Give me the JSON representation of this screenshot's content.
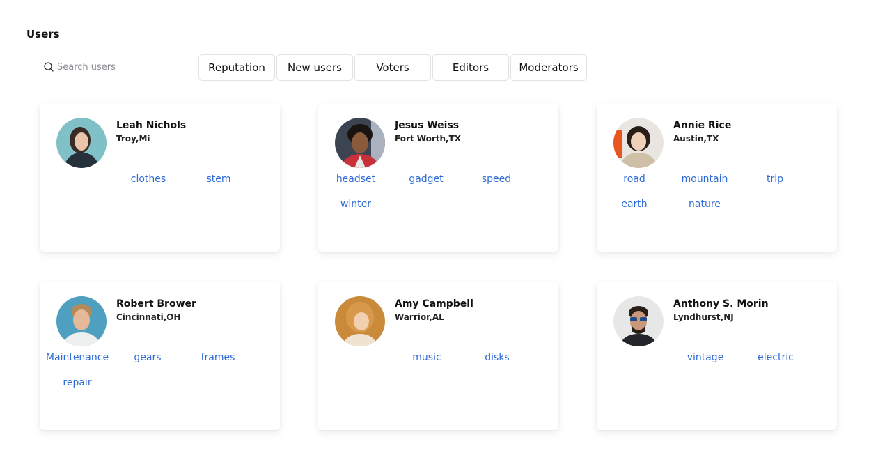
{
  "header": {
    "title": "Users"
  },
  "search": {
    "placeholder": "Search users"
  },
  "tabs": [
    "Reputation",
    "New users",
    "Voters",
    "Editors",
    "Moderators"
  ],
  "users": [
    {
      "name": "Leah Nichols",
      "location": "Troy,Mi",
      "tags": [
        "clothes",
        "stem"
      ]
    },
    {
      "name": "Jesus Weiss",
      "location": "Fort Worth,TX",
      "tags": [
        "headset",
        "gadget",
        "speed",
        "winter"
      ]
    },
    {
      "name": "Annie Rice",
      "location": "Austin,TX",
      "tags": [
        "road",
        "mountain",
        "trip",
        "earth",
        "nature"
      ]
    },
    {
      "name": "Robert Brower",
      "location": "Cincinnati,OH",
      "tags": [
        "Maintenance",
        "gears",
        "frames",
        "repair"
      ]
    },
    {
      "name": "Amy Campbell",
      "location": "Warrior,AL",
      "tags": [
        "music",
        "disks"
      ]
    },
    {
      "name": "Anthony S. Morin",
      "location": "Lyndhurst,NJ",
      "tags": [
        "vintage",
        "electric"
      ]
    }
  ],
  "colors": {
    "tag": "#2e6bd6",
    "text": "#111111",
    "placeholder": "#8b8b93"
  }
}
